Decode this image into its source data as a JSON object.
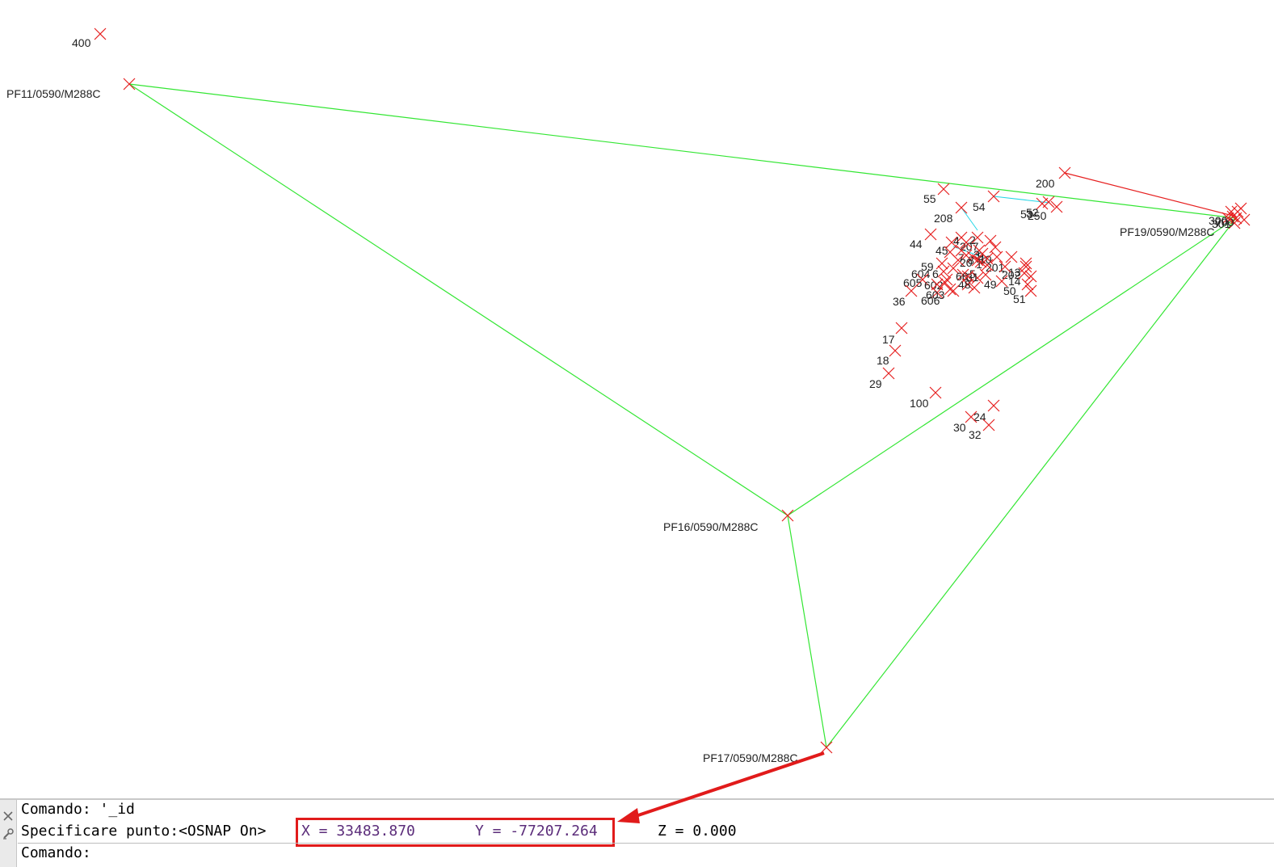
{
  "colors": {
    "network_line": "#33e633",
    "point_marker": "#e62020",
    "detail_line": "#e62020",
    "cyan_line": "#22d6e6",
    "highlight": "#e11b1b",
    "coord_text": "#5b2c7a"
  },
  "stations": [
    {
      "id": "pf11",
      "label": "PF11/0590/M288C"
    },
    {
      "id": "pf19",
      "label": "PF19/0590/M288C"
    },
    {
      "id": "pf16",
      "label": "PF16/0590/M288C"
    },
    {
      "id": "pf17",
      "label": "PF17/0590/M288C"
    }
  ],
  "points": [
    "400",
    "300",
    "200",
    "55",
    "54",
    "208",
    "53",
    "250",
    "52",
    "44",
    "45",
    "4",
    "2",
    "207",
    "59",
    "604",
    "6",
    "201",
    "202",
    "14",
    "49",
    "50",
    "51",
    "605",
    "602",
    "36",
    "606",
    "603",
    "17",
    "18",
    "29",
    "100",
    "24",
    "30",
    "32",
    "700",
    "301",
    "66",
    "8",
    "3",
    "7",
    "1",
    "48",
    "10",
    "13",
    "5",
    "20",
    "9",
    "31"
  ],
  "command_line": {
    "line1": "Comando: '_id",
    "line2_prefix": "Specificare punto:<OSNAP On>",
    "x_text": "X = 33483.870",
    "y_text": "Y = -77207.264",
    "z_text": "Z = 0.000",
    "line3": "Comando:"
  }
}
